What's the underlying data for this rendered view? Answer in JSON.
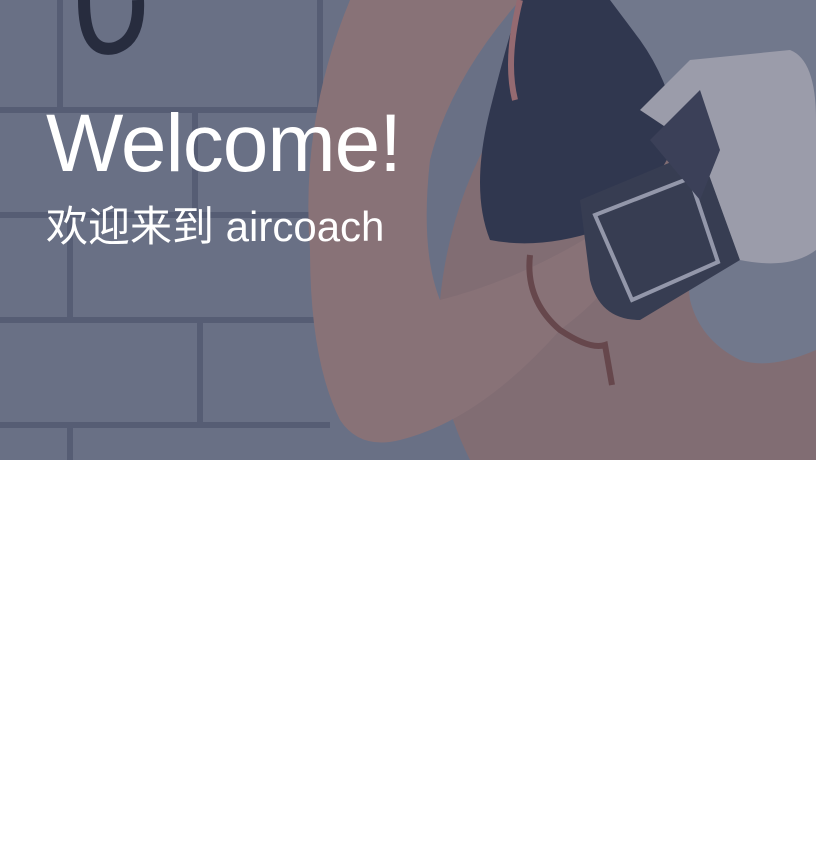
{
  "hero": {
    "title": "Welcome!",
    "subtitle": "欢迎来到 aircoach",
    "overlay_color": "#3e4870"
  },
  "colors": {
    "background": "#ffffff",
    "text_on_hero": "#ffffff"
  }
}
